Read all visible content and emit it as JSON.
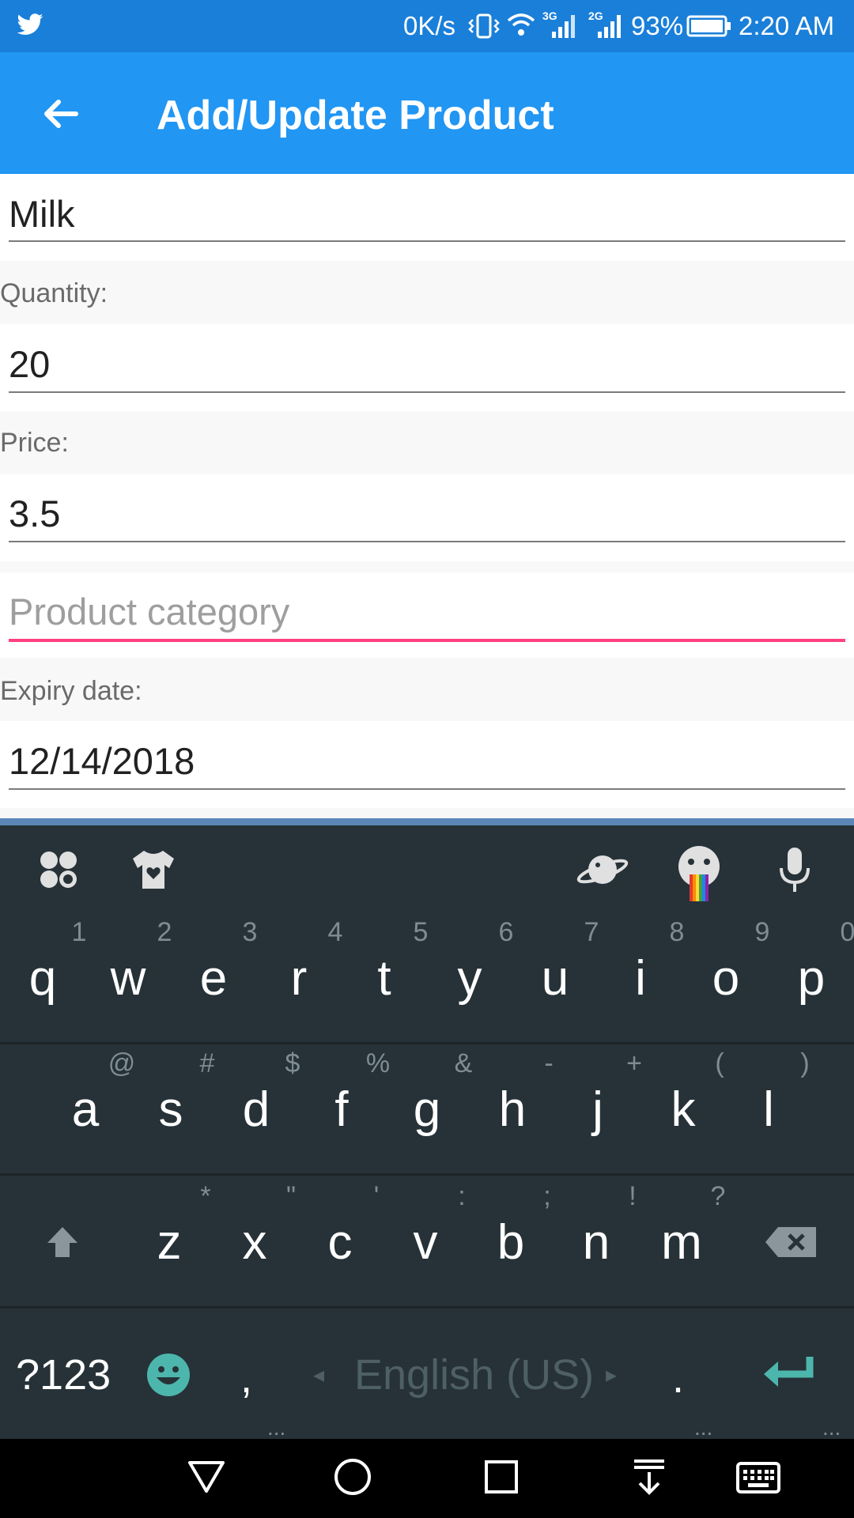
{
  "status_bar": {
    "speed": "0K/s",
    "battery": "93%",
    "time": "2:20 AM",
    "network_left": "3G",
    "network_right": "2G"
  },
  "app_bar": {
    "title": "Add/Update Product"
  },
  "form": {
    "name_value": "Milk",
    "quantity_label": "Quantity:",
    "quantity_value": "20",
    "price_label": "Price:",
    "price_value": "3.5",
    "category_placeholder": "Product category",
    "expiry_label": "Expiry date:",
    "expiry_value": "12/14/2018"
  },
  "keyboard": {
    "row1": [
      {
        "key": "q",
        "hint": "1"
      },
      {
        "key": "w",
        "hint": "2"
      },
      {
        "key": "e",
        "hint": "3"
      },
      {
        "key": "r",
        "hint": "4"
      },
      {
        "key": "t",
        "hint": "5"
      },
      {
        "key": "y",
        "hint": "6"
      },
      {
        "key": "u",
        "hint": "7"
      },
      {
        "key": "i",
        "hint": "8"
      },
      {
        "key": "o",
        "hint": "9"
      },
      {
        "key": "p",
        "hint": "0"
      }
    ],
    "row2": [
      {
        "key": "a",
        "hint": "@"
      },
      {
        "key": "s",
        "hint": "#"
      },
      {
        "key": "d",
        "hint": "$"
      },
      {
        "key": "f",
        "hint": "%"
      },
      {
        "key": "g",
        "hint": "&"
      },
      {
        "key": "h",
        "hint": "-"
      },
      {
        "key": "j",
        "hint": "+"
      },
      {
        "key": "k",
        "hint": "("
      },
      {
        "key": "l",
        "hint": ")"
      }
    ],
    "row3": [
      {
        "key": "z",
        "hint": "*"
      },
      {
        "key": "x",
        "hint": "\""
      },
      {
        "key": "c",
        "hint": "'"
      },
      {
        "key": "v",
        "hint": ":"
      },
      {
        "key": "b",
        "hint": ";"
      },
      {
        "key": "n",
        "hint": "!"
      },
      {
        "key": "m",
        "hint": "?"
      }
    ],
    "symbols_key": "?123",
    "comma_key": ",",
    "period_key": ".",
    "space_label": "English (US)",
    "accent_color": "#4db6ac"
  },
  "colors": {
    "status_bar": "#1a7fd9",
    "app_bar": "#2196f3",
    "focus_underline": "#ff4081",
    "keyboard_bg": "#263238"
  },
  "icons": {
    "back": "arrow-left-icon",
    "twitter": "twitter-bird-icon",
    "enter": "enter-arrow-icon",
    "backspace": "backspace-icon",
    "shift": "shift-arrow-icon"
  }
}
